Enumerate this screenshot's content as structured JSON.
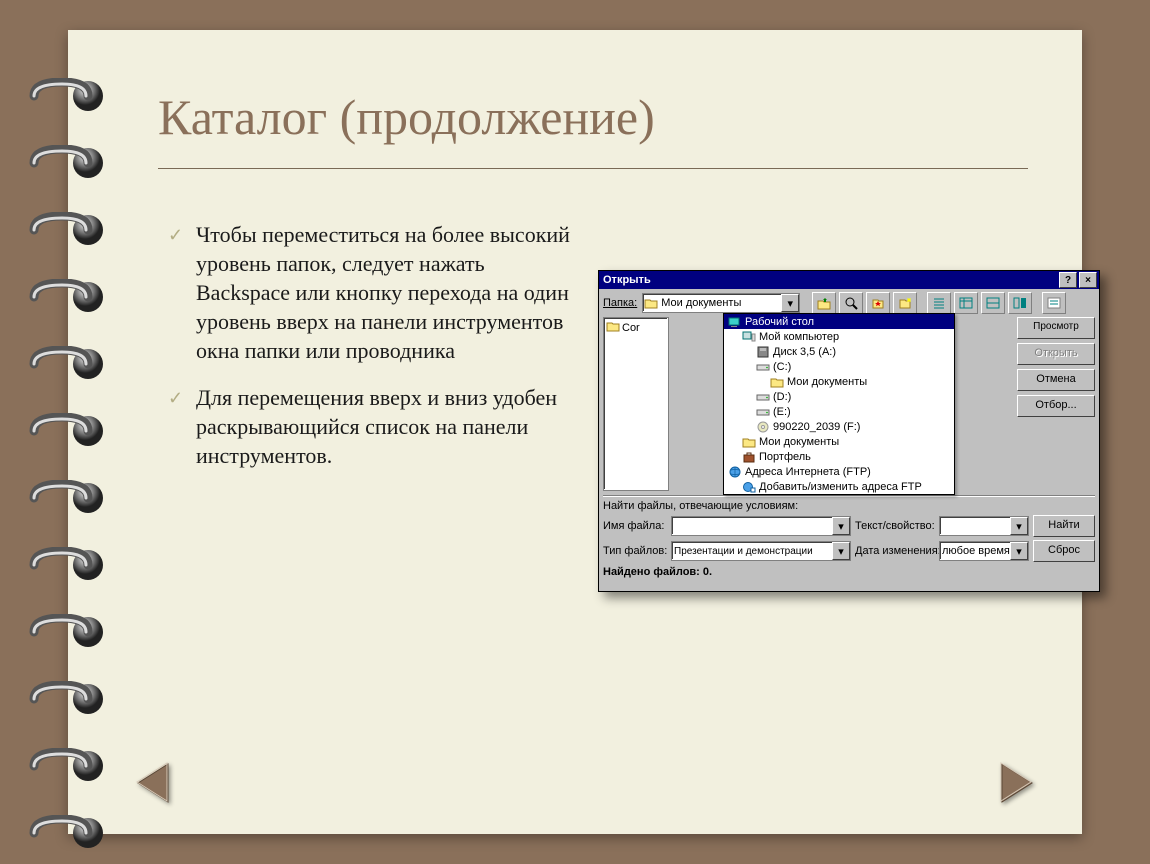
{
  "slide": {
    "title": "Каталог (продолжение)",
    "bullets": [
      "Чтобы переместиться на более высокий уровень папок, следует нажать Backspace или кнопку перехода на один уровень вверх на панели инструментов окна папки или проводника",
      "Для перемещения вверх и вниз удобен раскрывающийся список на панели инструментов."
    ]
  },
  "dialog": {
    "title": "Открыть",
    "titlebar_help": "?",
    "titlebar_close": "×",
    "folder_label": "Папка:",
    "folder_combo": "Мои документы",
    "filepane_item": "Cor",
    "tree": [
      {
        "indent": 1,
        "sel": true,
        "label": "Рабочий стол",
        "icon": "desktop"
      },
      {
        "indent": 2,
        "sel": false,
        "label": "Мой компьютер",
        "icon": "computer"
      },
      {
        "indent": 3,
        "sel": false,
        "label": "Диск 3,5 (A:)",
        "icon": "floppy"
      },
      {
        "indent": 3,
        "sel": false,
        "label": "(C:)",
        "icon": "drive"
      },
      {
        "indent": 4,
        "sel": false,
        "label": "Мои документы",
        "icon": "folder-open"
      },
      {
        "indent": 3,
        "sel": false,
        "label": "(D:)",
        "icon": "drive"
      },
      {
        "indent": 3,
        "sel": false,
        "label": "(E:)",
        "icon": "drive"
      },
      {
        "indent": 3,
        "sel": false,
        "label": "990220_2039 (F:)",
        "icon": "cd"
      },
      {
        "indent": 2,
        "sel": false,
        "label": "Мои документы",
        "icon": "folder"
      },
      {
        "indent": 2,
        "sel": false,
        "label": "Портфель",
        "icon": "briefcase"
      },
      {
        "indent": 1,
        "sel": false,
        "label": "Адреса Интернета (FTP)",
        "icon": "globe"
      },
      {
        "indent": 2,
        "sel": false,
        "label": "Добавить/изменить адреса FTP",
        "icon": "globe-add"
      }
    ],
    "buttons": {
      "preview": "Просмотр",
      "open": "Открыть",
      "cancel": "Отмена",
      "filter": "Отбор..."
    },
    "find_caption": "Найти файлы, отвечающие условиям:",
    "filename_label": "Имя файла:",
    "filetype_label": "Тип файлов:",
    "filetype_value": "Презентации и демонстрации",
    "text_label": "Текст/свойство:",
    "date_label": "Дата изменения:",
    "date_value": "любое время",
    "find_btn": "Найти",
    "reset_btn": "Сброс",
    "status": "Найдено файлов: 0."
  }
}
